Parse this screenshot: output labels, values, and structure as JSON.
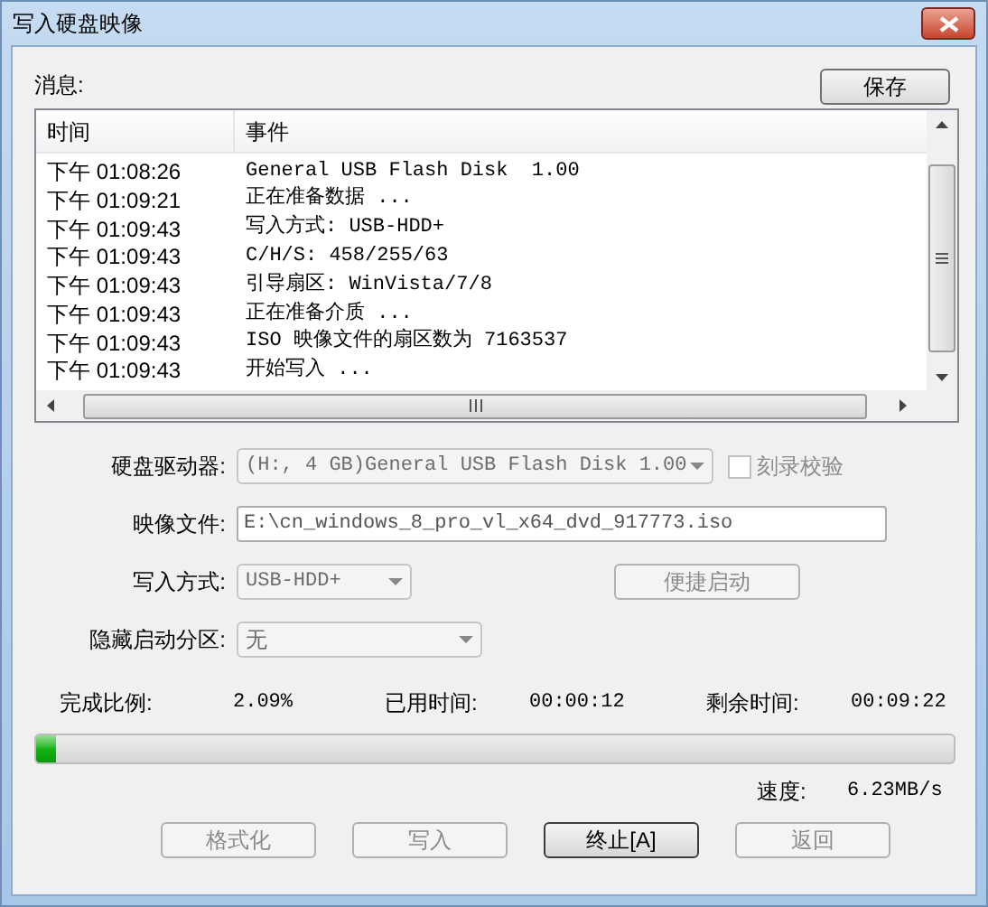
{
  "window": {
    "title": "写入硬盘映像"
  },
  "messages": {
    "label": "消息:",
    "save_button": "保存",
    "columns": [
      "时间",
      "事件"
    ],
    "rows": [
      {
        "time": "下午 01:08:26",
        "event": "General USB Flash Disk  1.00"
      },
      {
        "time": "下午 01:09:21",
        "event": "正在准备数据 ..."
      },
      {
        "time": "下午 01:09:43",
        "event": "写入方式: USB-HDD+"
      },
      {
        "time": "下午 01:09:43",
        "event": "C/H/S: 458/255/63"
      },
      {
        "time": "下午 01:09:43",
        "event": "引导扇区: WinVista/7/8"
      },
      {
        "time": "下午 01:09:43",
        "event": "正在准备介质 ..."
      },
      {
        "time": "下午 01:09:43",
        "event": "ISO 映像文件的扇区数为 7163537"
      },
      {
        "time": "下午 01:09:43",
        "event": "开始写入 ..."
      }
    ]
  },
  "form": {
    "drive": {
      "label": "硬盘驱动器:",
      "value": "(H:, 4 GB)General USB Flash Disk  1.00",
      "disabled": true
    },
    "verify": {
      "label": "刻录校验",
      "checked": false,
      "disabled": true
    },
    "image_file": {
      "label": "映像文件:",
      "value": "E:\\cn_windows_8_pro_vl_x64_dvd_917773.iso"
    },
    "write_mode": {
      "label": "写入方式:",
      "value": "USB-HDD+",
      "disabled": true
    },
    "quick_boot": {
      "label": "便捷启动",
      "disabled": true
    },
    "hidden_partition": {
      "label": "隐藏启动分区:",
      "value": "无",
      "disabled": true
    }
  },
  "progress": {
    "done_label": "完成比例:",
    "done_value": "2.09%",
    "elapsed_label": "已用时间:",
    "elapsed_value": "00:00:12",
    "remaining_label": "剩余时间:",
    "remaining_value": "00:09:22",
    "level": 0.0209,
    "speed_label": "速度:",
    "speed_value": "6.23MB/s"
  },
  "buttons": [
    {
      "label": "格式化",
      "disabled": true
    },
    {
      "label": "写入",
      "disabled": true
    },
    {
      "label": "终止[A]",
      "disabled": false
    },
    {
      "label": "返回",
      "disabled": true
    }
  ]
}
